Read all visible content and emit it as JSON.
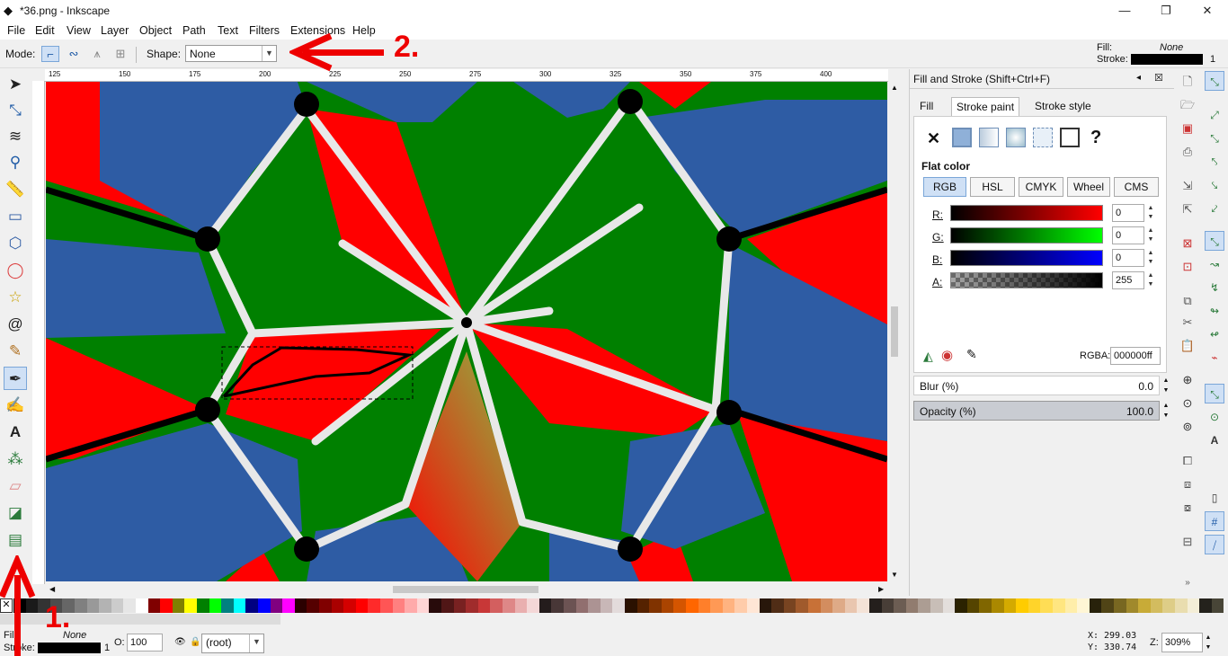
{
  "window": {
    "title": "*36.png - Inkscape",
    "controls": [
      "—",
      "❐",
      "✕"
    ]
  },
  "menu": [
    "File",
    "Edit",
    "View",
    "Layer",
    "Object",
    "Path",
    "Text",
    "Filters",
    "Extensions",
    "Help"
  ],
  "tool_controls": {
    "mode_label": "Mode:",
    "shape_label": "Shape:",
    "shape_value": "None"
  },
  "fill_stroke_indicator": {
    "fill_label": "Fill:",
    "fill_value": "None",
    "stroke_label": "Stroke:",
    "stroke_width": "1"
  },
  "ruler_ticks": [
    "125",
    "150",
    "175",
    "200",
    "225",
    "250",
    "275",
    "300",
    "325",
    "350",
    "375",
    "400"
  ],
  "canvas": {
    "colors": {
      "red": "#ff0000",
      "blue": "#2e5ca4",
      "green": "#008000",
      "edge": "#e8e8e8",
      "node": "#000000"
    }
  },
  "panel": {
    "title": "Fill and Stroke (Shift+Ctrl+F)",
    "tabs": [
      "Fill",
      "Stroke paint",
      "Stroke style"
    ],
    "paint_types": [
      "✕",
      "flat",
      "linear",
      "radial",
      "pattern",
      "swatch",
      "?"
    ],
    "flat_color_label": "Flat color",
    "modes": [
      "RGB",
      "HSL",
      "CMYK",
      "Wheel",
      "CMS"
    ],
    "channels": [
      {
        "label": "R:",
        "value": "0"
      },
      {
        "label": "G:",
        "value": "0"
      },
      {
        "label": "B:",
        "value": "0"
      },
      {
        "label": "A:",
        "value": "255"
      }
    ],
    "rgba_label": "RGBA:",
    "rgba_value": "000000ff",
    "blur_label": "Blur (%)",
    "blur_value": "0.0",
    "opacity_label": "Opacity (%)",
    "opacity_value": "100.0"
  },
  "annotations": {
    "label1": "1.",
    "label2": "2."
  },
  "statusbar": {
    "fill_label": "Fill:",
    "fill_value": "None",
    "stroke_label": "Stroke:",
    "stroke_width": "1",
    "opacity_label": "O:",
    "opacity_value": "100",
    "layer_value": "(root)",
    "x_label": "X:",
    "x_value": "299.03",
    "y_label": "Y:",
    "y_value": "330.74",
    "zoom_label": "Z:",
    "zoom_value": "309%"
  },
  "palette_colors": [
    "#000000",
    "#1a1a1a",
    "#333333",
    "#4d4d4d",
    "#666666",
    "#808080",
    "#999999",
    "#b3b3b3",
    "#cccccc",
    "#e6e6e6",
    "#ffffff",
    "#800000",
    "#ff0000",
    "#808000",
    "#ffff00",
    "#008000",
    "#00ff00",
    "#008080",
    "#00ffff",
    "#000080",
    "#0000ff",
    "#800080",
    "#ff00ff",
    "#2b0000",
    "#550000",
    "#800000",
    "#aa0000",
    "#d40000",
    "#ff0000",
    "#ff2a2a",
    "#ff5555",
    "#ff8080",
    "#ffaaaa",
    "#ffd5d5",
    "#280b0b",
    "#501616",
    "#782121",
    "#a02c2c",
    "#c83737",
    "#d35f5f",
    "#de8787",
    "#e9afaf",
    "#f4d7d7",
    "#241c1c",
    "#483737",
    "#6c5353",
    "#916f6f",
    "#ac9393",
    "#c8b7b7",
    "#e3dbdb",
    "#2b1100",
    "#552200",
    "#803300",
    "#aa4400",
    "#d45500",
    "#ff6600",
    "#ff7f2a",
    "#ff9955",
    "#ffb380",
    "#ffccaa",
    "#ffe6d5",
    "#28170b",
    "#502d16",
    "#784421",
    "#a05a2c",
    "#c87137",
    "#d38d5f",
    "#deaa87",
    "#e9c6af",
    "#f4e3d7",
    "#241f1c",
    "#483e37",
    "#6c5d53",
    "#917c6f",
    "#ac9d93",
    "#c8beb7",
    "#e3dedb",
    "#2b2200",
    "#554400",
    "#806600",
    "#aa8800",
    "#d4aa00",
    "#ffcc00",
    "#ffd42a",
    "#ffdd55",
    "#ffe680",
    "#ffeeaa",
    "#fff6d5",
    "#28220b",
    "#504416",
    "#786721",
    "#a0892c",
    "#c8ab37",
    "#d3bc5f",
    "#decd87",
    "#e9ddaf",
    "#f4eed7",
    "#24221c",
    "#484537",
    "#6c6753",
    "#918a6f",
    "#aca793",
    "#c8c4b7"
  ]
}
